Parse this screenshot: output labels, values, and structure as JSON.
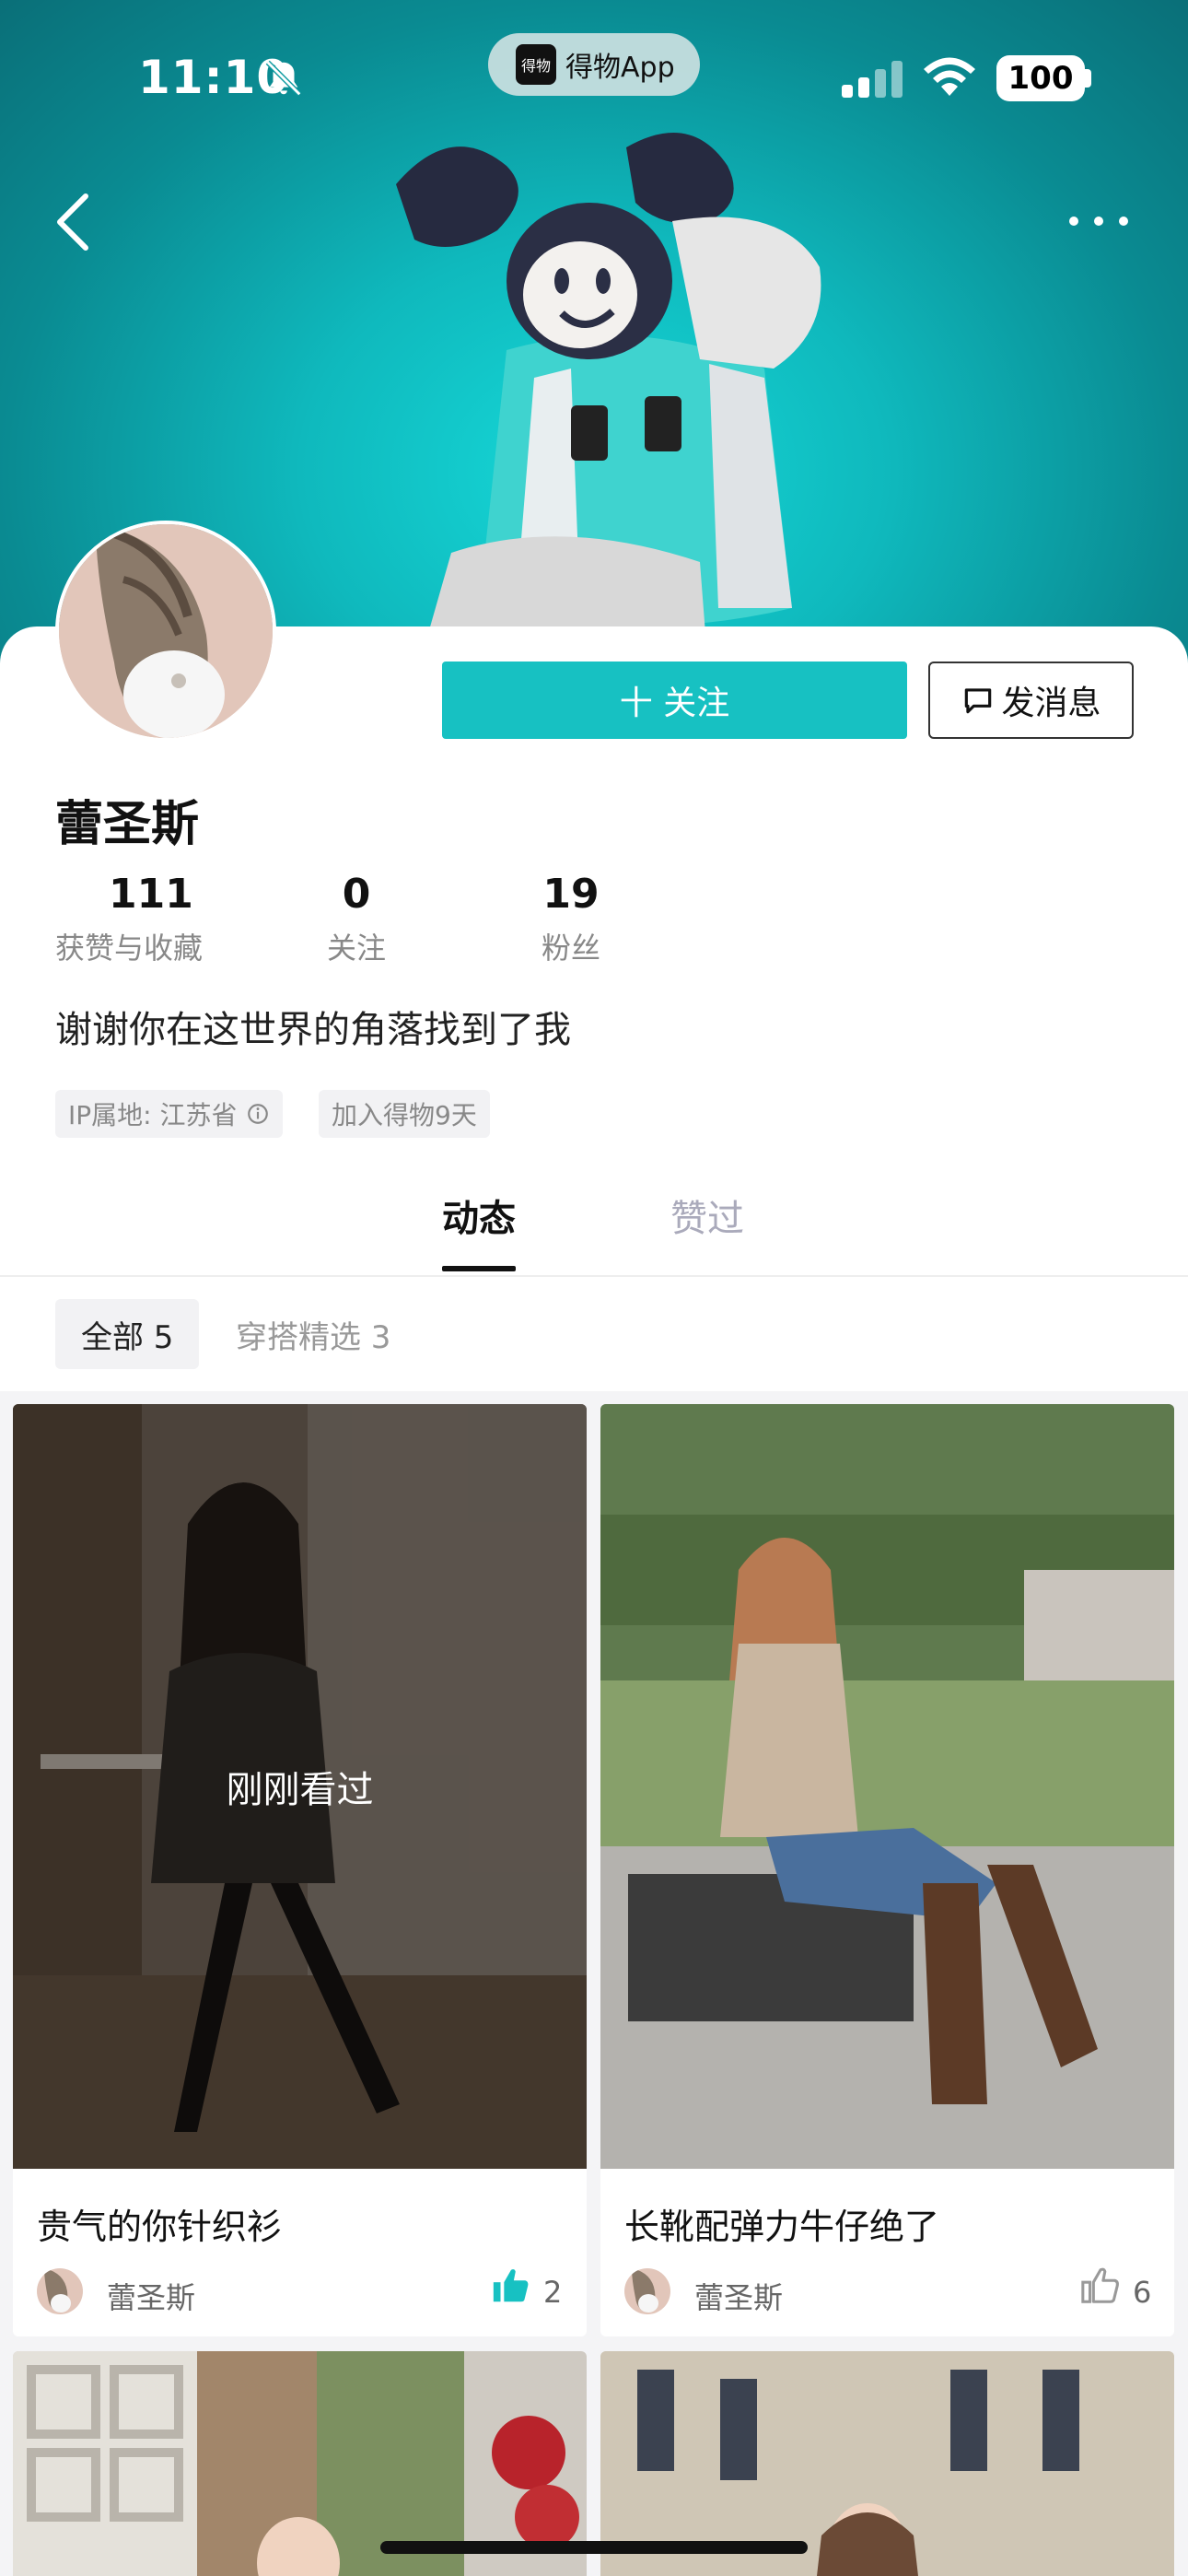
{
  "status_bar": {
    "time": "11:10",
    "battery": "100",
    "app_pill_label": "得物App",
    "app_logo_text": "得物"
  },
  "profile": {
    "name": "蕾圣斯",
    "follow_label": "十 关注",
    "message_label": "发消息",
    "stats": [
      {
        "value": "111",
        "label": "获赞与收藏"
      },
      {
        "value": "0",
        "label": "关注"
      },
      {
        "value": "19",
        "label": "粉丝"
      }
    ],
    "bio": "谢谢你在这世界的角落找到了我",
    "tags": {
      "ip": "IP属地: 江苏省",
      "joined": "加入得物9天"
    }
  },
  "tabs": [
    {
      "label": "动态"
    },
    {
      "label": "赞过"
    }
  ],
  "filters": [
    {
      "label": "全部 5"
    },
    {
      "label": "穿搭精选 3"
    }
  ],
  "posts": [
    {
      "title": "贵气的你针织衫",
      "author": "蕾圣斯",
      "likes": "2",
      "overlay": "刚刚看过",
      "liked": true
    },
    {
      "title": "长靴配弹力牛仔绝了",
      "author": "蕾圣斯",
      "likes": "6",
      "liked": false
    }
  ],
  "colors": {
    "accent": "#17c1c2",
    "banner": "#0fb9bd"
  }
}
